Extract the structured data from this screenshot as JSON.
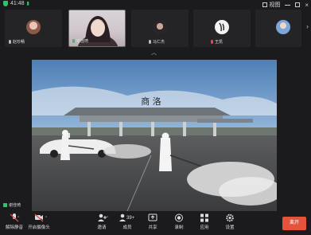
{
  "status_bar": {
    "time": "41:48",
    "view_label": "视图"
  },
  "participants": [
    {
      "name": "赵珍畅",
      "has_video": false,
      "muted": false
    },
    {
      "name": "谢佳琦",
      "has_video": true,
      "muted": false
    },
    {
      "name": "马仁杰",
      "has_video": false,
      "muted": false
    },
    {
      "name": "王凯",
      "has_video": false,
      "muted": true
    },
    {
      "name": "",
      "has_video": false,
      "muted": false
    }
  ],
  "share": {
    "sign_text": "商 洛"
  },
  "presenter": {
    "name": "谢佳琦"
  },
  "toolbar": {
    "unmute": "解除静音",
    "video": "开启摄像头",
    "invite": "邀请",
    "members": "成员",
    "members_count": "39+",
    "share": "共享",
    "record": "录制",
    "apps": "应用",
    "settings": "设置",
    "leave": "离开"
  },
  "colors": {
    "accent_green": "#2ec36b",
    "leave_red": "#e5533a",
    "bg": "#1b1b1d"
  }
}
